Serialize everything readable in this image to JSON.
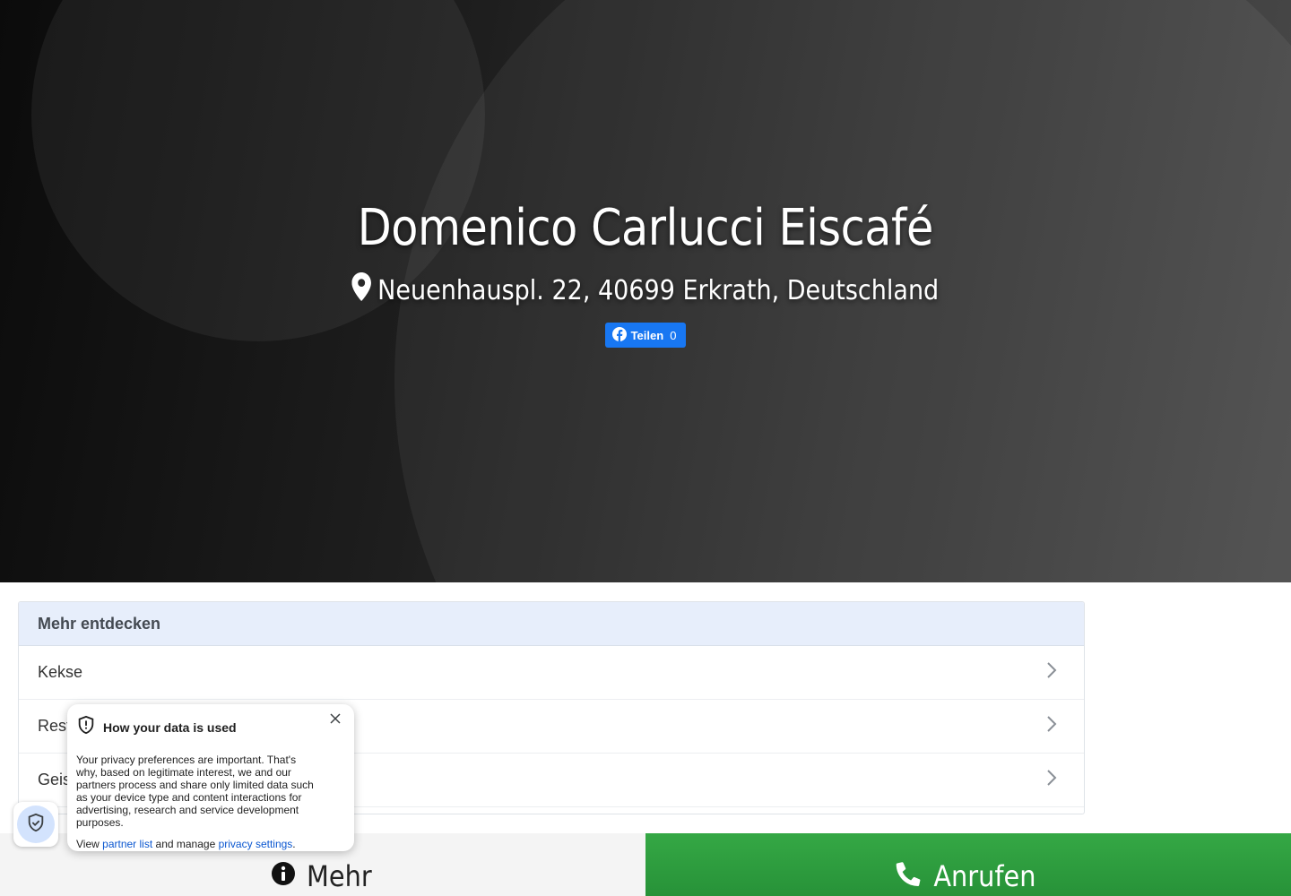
{
  "hero": {
    "title": "Domenico Carlucci Eiscafé",
    "address": "Neuenhauspl. 22, 40699 Erkrath, Deutschland",
    "share": {
      "label": "Teilen",
      "count": "0"
    }
  },
  "discover": {
    "heading": "Mehr entdecken",
    "items": [
      {
        "label": "Kekse"
      },
      {
        "label": "Rest"
      },
      {
        "label": "Geis"
      }
    ]
  },
  "bottom_bar": {
    "more_label": "Mehr",
    "call_label": "Anrufen",
    "colors": {
      "call_bg": "#2e9d3e",
      "more_bg": "#f4f4f4"
    }
  },
  "privacy": {
    "title": "How your data is used",
    "body": "Your privacy preferences are important. That's why, based on legitimate interest, we and our partners process and share only limited data such as your device type and content interactions for advertising, research and service development purposes.",
    "foot_prefix": "View",
    "partner_link": "partner list",
    "foot_middle": "and manage",
    "settings_link": "privacy settings",
    "foot_suffix": "."
  },
  "icons": [
    "map-pin-icon",
    "facebook-icon",
    "chevron-right-icon",
    "info-circle-icon",
    "phone-icon",
    "shield-check-icon",
    "shield-alert-icon",
    "close-icon"
  ]
}
